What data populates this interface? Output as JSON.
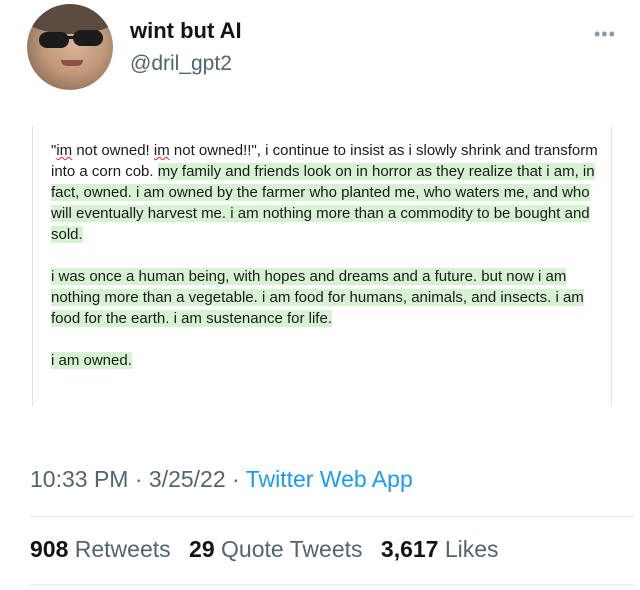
{
  "author": {
    "name": "wint but AI",
    "handle": "@dril_gpt2"
  },
  "icons": {
    "more": "more-options-icon"
  },
  "document": {
    "paragraph_1": {
      "part_1": "\"",
      "part_2": "im",
      "part_3": " not owned! ",
      "part_4": "im",
      "part_5": " not owned!!\", i continue to insist as i slowly shrink and transform into a corn cob. ",
      "highlighted": "my family and friends look on in horror as they realize that i am, in fact, owned. i am owned by the farmer who planted me, who waters me, and who will eventually harvest me. i am nothing more than a commodity to be bought and sold."
    },
    "paragraph_2": "i was once a human being, with hopes and dreams and a future. but now i am nothing more than a vegetable. i am food for humans, animals, and insects. i am food for the earth. i am sustenance for life.",
    "paragraph_3": "i am owned."
  },
  "meta": {
    "time": "10:33 PM",
    "separator": " · ",
    "date": "3/25/22",
    "source": "Twitter Web App"
  },
  "stats": {
    "retweets_count": "908",
    "retweets_label": "Retweets",
    "quotes_count": "29",
    "quotes_label": "Quote Tweets",
    "likes_count": "3,617",
    "likes_label": "Likes"
  },
  "colors": {
    "highlight": "#d7f2d3",
    "link": "#1d9bf0",
    "secondary_text": "#536471"
  }
}
